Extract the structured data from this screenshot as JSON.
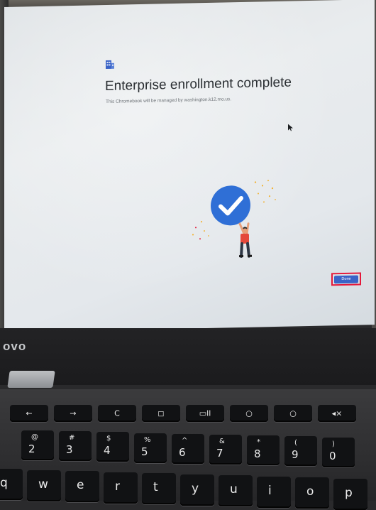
{
  "dialog": {
    "title": "Enterprise enrollment complete",
    "subtitle": "This Chromebook will be managed by washington.k12.mo.us.",
    "done_label": "Done",
    "building_icon": "building-icon",
    "illustration_icon": "person-holding-checkmark"
  },
  "laptop": {
    "brand": "ovo"
  },
  "keyboard": {
    "function_row": [
      {
        "name": "back-key",
        "label": "←"
      },
      {
        "name": "forward-key",
        "label": "→"
      },
      {
        "name": "refresh-key",
        "label": "C"
      },
      {
        "name": "fullscreen-key",
        "label": "◻"
      },
      {
        "name": "overview-key",
        "label": "▭ll"
      },
      {
        "name": "brightness-down-key",
        "label": "○"
      },
      {
        "name": "brightness-up-key",
        "label": "○"
      },
      {
        "name": "mute-key",
        "label": "◂×"
      }
    ],
    "number_row": [
      {
        "name": "key-2",
        "top": "@",
        "bottom": "2"
      },
      {
        "name": "key-3",
        "top": "#",
        "bottom": "3"
      },
      {
        "name": "key-4",
        "top": "$",
        "bottom": "4"
      },
      {
        "name": "key-5",
        "top": "%",
        "bottom": "5"
      },
      {
        "name": "key-6",
        "top": "^",
        "bottom": "6"
      },
      {
        "name": "key-7",
        "top": "&",
        "bottom": "7"
      },
      {
        "name": "key-8",
        "top": "*",
        "bottom": "8"
      },
      {
        "name": "key-9",
        "top": "(",
        "bottom": "9"
      },
      {
        "name": "key-0",
        "top": ")",
        "bottom": "0"
      }
    ],
    "letter_row": [
      {
        "name": "key-q",
        "label": "q"
      },
      {
        "name": "key-w",
        "label": "w"
      },
      {
        "name": "key-e",
        "label": "e"
      },
      {
        "name": "key-r",
        "label": "r"
      },
      {
        "name": "key-t",
        "label": "t"
      },
      {
        "name": "key-y",
        "label": "y"
      },
      {
        "name": "key-u",
        "label": "u"
      },
      {
        "name": "key-i",
        "label": "i"
      },
      {
        "name": "key-o",
        "label": "o"
      },
      {
        "name": "key-p",
        "label": "p"
      }
    ]
  },
  "colors": {
    "accent": "#3a63c7",
    "highlight": "#e4183a",
    "check_circle": "#2f6fd6"
  }
}
